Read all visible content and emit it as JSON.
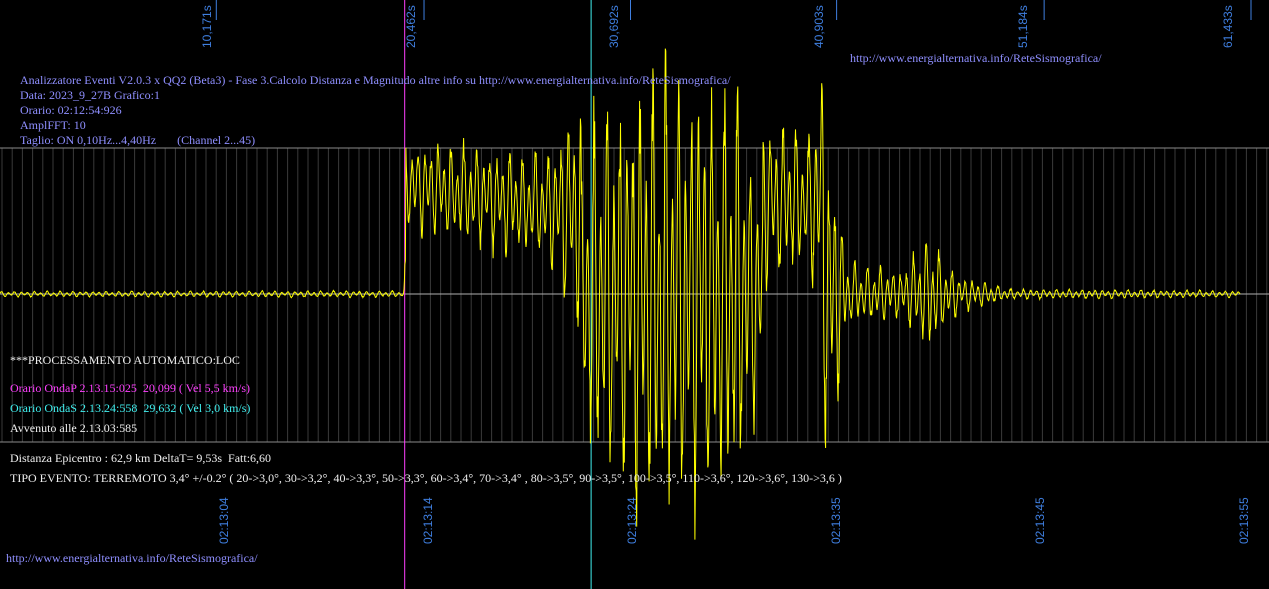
{
  "header": {
    "title": "Analizzatore Eventi V2.0.3 x QQ2 (Beta3) - Fase 3.Calcolo Distanza e Magnitudo altre info su http://www.energialternativa.info/ReteSismografica/",
    "data": "Data: 2023_9_27B Grafico:1",
    "orario": "Orario: 02:12:54:926",
    "ampl": "AmplFFT: 10",
    "taglio": "Taglio: ON 0,10Hz...4,40Hz       (Channel 2...45)",
    "url_top": "http://www.energialternativa.info/ReteSismografica/"
  },
  "results": {
    "processing": "***PROCESSAMENTO AUTOMATICO:LOC",
    "p_wave": "Orario OndaP 2.13.15:025  20,099 ( Vel 5,5 km/s)",
    "s_wave": "Orario OndaS 2.13.24:558  29,632 ( Vel 3,0 km/s)",
    "occurred": "Avvenuto alle 2.13.03:585",
    "distance": "Distanza Epicentro : 62,9 km DeltaT= 9,53s  Fatt:6,60",
    "event_type": "TIPO EVENTO: TERREMOTO 3,4° +/-0.2° ( 20->3,0°, 30->3,2°, 40->3,3°, 50->3,3°, 60->3,4°, 70->3,4° , 80->3,5°, 90->3,5°, 100->3,5°, 110->3,6°, 120->3,6°, 130->3,6 )"
  },
  "footer": {
    "url": "http://www.energialternativa.info/ReteSismografica/"
  },
  "colors": {
    "background": "#000000",
    "trace": "#ffff00",
    "grid": "#5a5a5a",
    "p_marker": "#ff40ff",
    "s_marker": "#40f0f0",
    "axis_label": "#3f7fe0",
    "header_text": "#8f8fff"
  },
  "chart_data": {
    "type": "line",
    "series": [
      {
        "values": []
      }
    ],
    "xlim": [
      0,
      61.433
    ],
    "top_ticks_s": [
      "10,171s",
      "20,462s",
      "30,692s",
      "40,903s",
      "51,184s",
      "61,433s"
    ],
    "bottom_ticks_time": [
      "02:13:04",
      "02:13:14",
      "02:13:24",
      "02:13:35",
      "02:13:45",
      "02:13:55"
    ],
    "markers": {
      "p_wave_s": 20.099,
      "s_wave_s": 29.632
    },
    "trace_envelope": [
      {
        "t": 0,
        "a": 0.04
      },
      {
        "t": 20.0,
        "a": 0.05
      },
      {
        "t": 20.1,
        "a": 0.7
      },
      {
        "t": 27.0,
        "a": 0.8
      },
      {
        "t": 28.5,
        "a": 1.6
      },
      {
        "t": 29.2,
        "a": 2.6
      },
      {
        "t": 31.5,
        "a": 3.2
      },
      {
        "t": 34.0,
        "a": 3.4
      },
      {
        "t": 36.5,
        "a": 3.0
      },
      {
        "t": 38.0,
        "a": 1.2
      },
      {
        "t": 40.0,
        "a": 1.0
      },
      {
        "t": 41.2,
        "a": 2.4
      },
      {
        "t": 42.0,
        "a": 0.5
      },
      {
        "t": 44.5,
        "a": 0.35
      },
      {
        "t": 46.0,
        "a": 0.9
      },
      {
        "t": 47.5,
        "a": 0.3
      },
      {
        "t": 50.0,
        "a": 0.08
      },
      {
        "t": 61.433,
        "a": 0.05
      }
    ],
    "grid": true
  }
}
